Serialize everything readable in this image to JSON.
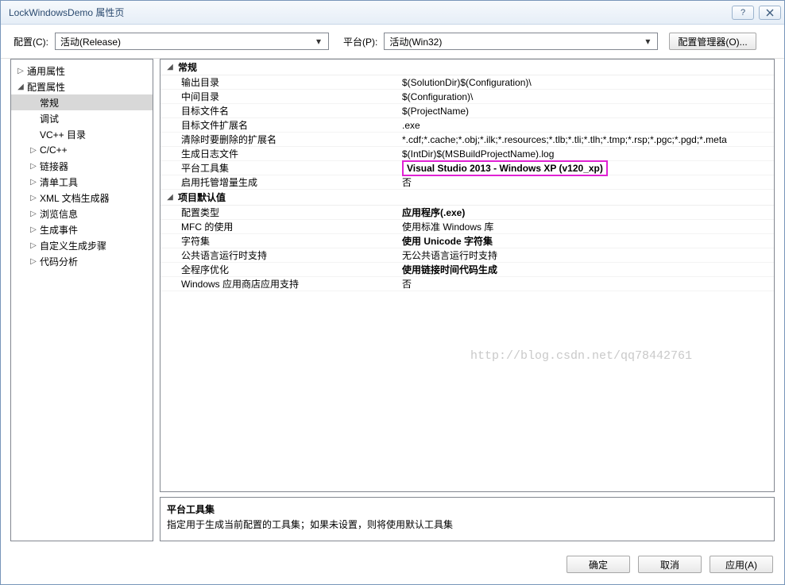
{
  "window": {
    "title": "LockWindowsDemo 属性页"
  },
  "toolbar": {
    "config_label": "配置(C):",
    "config_value": "活动(Release)",
    "platform_label": "平台(P):",
    "platform_value": "活动(Win32)",
    "config_mgr_label": "配置管理器(O)..."
  },
  "tree": {
    "items": [
      {
        "label": "通用属性",
        "depth": 0,
        "tw": "▷"
      },
      {
        "label": "配置属性",
        "depth": 0,
        "tw": "◢"
      },
      {
        "label": "常规",
        "depth": 1,
        "tw": "",
        "sel": true
      },
      {
        "label": "调试",
        "depth": 1,
        "tw": ""
      },
      {
        "label": "VC++ 目录",
        "depth": 1,
        "tw": ""
      },
      {
        "label": "C/C++",
        "depth": 1,
        "tw": "▷"
      },
      {
        "label": "链接器",
        "depth": 1,
        "tw": "▷"
      },
      {
        "label": "清单工具",
        "depth": 1,
        "tw": "▷"
      },
      {
        "label": "XML 文档生成器",
        "depth": 1,
        "tw": "▷"
      },
      {
        "label": "浏览信息",
        "depth": 1,
        "tw": "▷"
      },
      {
        "label": "生成事件",
        "depth": 1,
        "tw": "▷"
      },
      {
        "label": "自定义生成步骤",
        "depth": 1,
        "tw": "▷"
      },
      {
        "label": "代码分析",
        "depth": 1,
        "tw": "▷"
      }
    ]
  },
  "groups": [
    {
      "name": "常规",
      "rows": [
        {
          "label": "输出目录",
          "value": "$(SolutionDir)$(Configuration)\\"
        },
        {
          "label": "中间目录",
          "value": "$(Configuration)\\"
        },
        {
          "label": "目标文件名",
          "value": "$(ProjectName)"
        },
        {
          "label": "目标文件扩展名",
          "value": ".exe"
        },
        {
          "label": "清除时要删除的扩展名",
          "value": "*.cdf;*.cache;*.obj;*.ilk;*.resources;*.tlb;*.tli;*.tlh;*.tmp;*.rsp;*.pgc;*.pgd;*.meta"
        },
        {
          "label": "生成日志文件",
          "value": "$(IntDir)$(MSBuildProjectName).log"
        },
        {
          "label": "平台工具集",
          "value": "Visual Studio 2013 - Windows XP (v120_xp)",
          "bold": true,
          "highlight": true
        },
        {
          "label": "启用托管增量生成",
          "value": "否"
        }
      ]
    },
    {
      "name": "项目默认值",
      "rows": [
        {
          "label": "配置类型",
          "value": "应用程序(.exe)",
          "bold": true
        },
        {
          "label": "MFC 的使用",
          "value": "使用标准 Windows 库"
        },
        {
          "label": "字符集",
          "value": "使用 Unicode 字符集",
          "bold": true
        },
        {
          "label": "公共语言运行时支持",
          "value": "无公共语言运行时支持"
        },
        {
          "label": "全程序优化",
          "value": "使用链接时间代码生成",
          "bold": true
        },
        {
          "label": "Windows 应用商店应用支持",
          "value": "否"
        }
      ]
    }
  ],
  "desc": {
    "title": "平台工具集",
    "text": "指定用于生成当前配置的工具集；如果未设置，则将使用默认工具集"
  },
  "footer": {
    "ok": "确定",
    "cancel": "取消",
    "apply": "应用(A)"
  },
  "watermark": "http://blog.csdn.net/qq78442761"
}
